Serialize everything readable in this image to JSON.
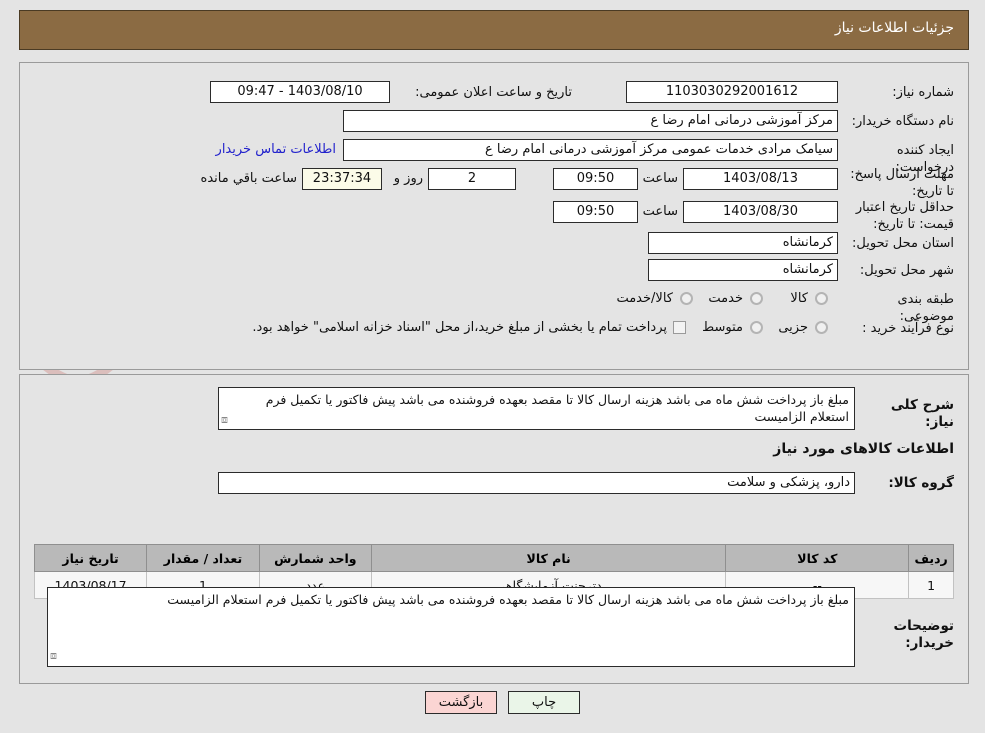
{
  "header": {
    "title": "جزئیات اطلاعات نیاز"
  },
  "form": {
    "need_number_label": "شماره نیاز:",
    "need_number_value": "1103030292001612",
    "announce_label": "تاریخ و ساعت اعلان عمومی:",
    "announce_value": "1403/08/10 - 09:47",
    "buyer_org_label": "نام دستگاه خریدار:",
    "buyer_org_value": "مرکز آموزشی  درمانی امام رضا  ع",
    "requester_label": "ایجاد کننده درخواست:",
    "requester_value": "سیامک مرادی خدمات عمومی مرکز آموزشی  درمانی امام رضا  ع",
    "contact_link": "اطلاعات تماس خریدار",
    "deadline_label": "مهلت ارسال پاسخ: تا تاریخ:",
    "deadline_date": "1403/08/13",
    "hour_label": "ساعت",
    "deadline_time": "09:50",
    "days_remaining": "2",
    "days_word": "روز و",
    "time_remaining": "23:37:34",
    "remaining_word": "ساعت باقي مانده",
    "price_validity_label": "حداقل تاریخ اعتبار قیمت: تا تاریخ:",
    "price_validity_date": "1403/08/30",
    "price_validity_time": "09:50",
    "province_label": "استان محل تحویل:",
    "province_value": "کرمانشاه",
    "city_label": "شهر محل تحویل:",
    "city_value": "کرمانشاه",
    "classification_label": "طبقه بندی موضوعی:",
    "classification_options": [
      "کالا",
      "خدمت",
      "کالا/خدمت"
    ],
    "purchase_type_label": "نوع فرآیند خرید :",
    "purchase_type_options": [
      "جزیی",
      "متوسط"
    ],
    "treasury_checkbox_label": "پرداخت تمام یا بخشی از مبلغ خرید،از محل \"اسناد خزانه اسلامی\" خواهد بود."
  },
  "description": {
    "label": "شرح کلی نیاز:",
    "value": "مبلغ باز پرداخت شش ماه می باشد هزینه ارسال کالا تا مقصد بعهده فروشنده می باشد پیش فاکتور یا تکمیل فرم استعلام الزامیست"
  },
  "goods_section": {
    "title": "اطلاعات کالاهای مورد نیاز",
    "group_label": "گروه کالا:",
    "group_value": "دارو، پزشکی و سلامت",
    "columns": [
      "ردیف",
      "کد کالا",
      "نام کالا",
      "واحد شمارش",
      "تعداد / مقدار",
      "تاریخ نیاز"
    ],
    "rows": [
      {
        "row": "1",
        "code": "--",
        "name": "دترجنت آزمایشگاهی",
        "unit": "عدد",
        "quantity": "1",
        "need_date": "1403/08/17"
      }
    ]
  },
  "buyer_notes": {
    "label": "توضیحات خریدار:",
    "value": "مبلغ باز پرداخت شش ماه می باشد هزینه ارسال کالا تا مقصد بعهده فروشنده می باشد پیش فاکتور یا تکمیل فرم استعلام الزامیست"
  },
  "buttons": {
    "print": "چاپ",
    "back": "بازگشت"
  },
  "watermark": {
    "text": "AriaTender.net"
  },
  "colors": {
    "header_bar": "#8b6b43",
    "page_bg": "#e4e4e4",
    "link": "#2222cc",
    "print_btn": "#eaf5e8",
    "back_btn": "#fbd5d3",
    "table_header": "#b9b9b9"
  }
}
